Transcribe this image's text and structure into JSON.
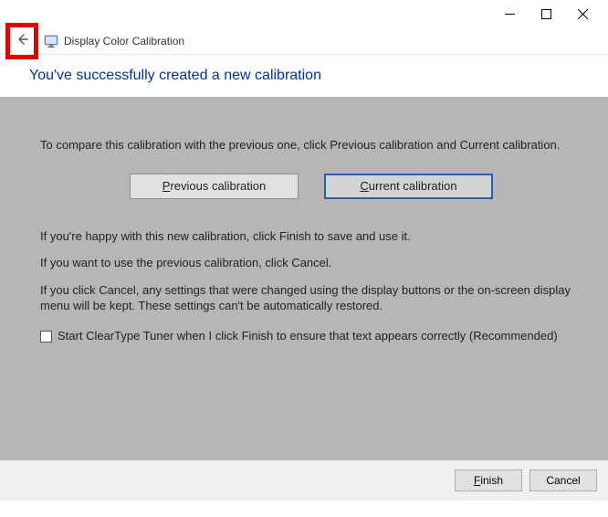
{
  "window": {
    "title": "Display Color Calibration"
  },
  "heading": "You've successfully created a new calibration",
  "body": {
    "intro": "To compare this calibration with the previous one, click Previous calibration and Current calibration.",
    "prev_btn_letter": "P",
    "prev_btn_rest": "revious calibration",
    "curr_btn_letter": "C",
    "curr_btn_rest": "urrent calibration",
    "happy": "If you're happy with this new calibration, click Finish to save and use it.",
    "use_prev": "If you want to use the previous calibration, click Cancel.",
    "cancel_note": "If you click Cancel, any settings that were changed using the display buttons or the on-screen display menu will be kept. These settings can't be automatically restored.",
    "checkbox_letter": "S",
    "checkbox_rest": "tart ClearType Tuner when I click Finish to ensure that text appears correctly (Recommended)"
  },
  "footer": {
    "finish_letter": "F",
    "finish_rest": "inish",
    "cancel": "Cancel"
  }
}
